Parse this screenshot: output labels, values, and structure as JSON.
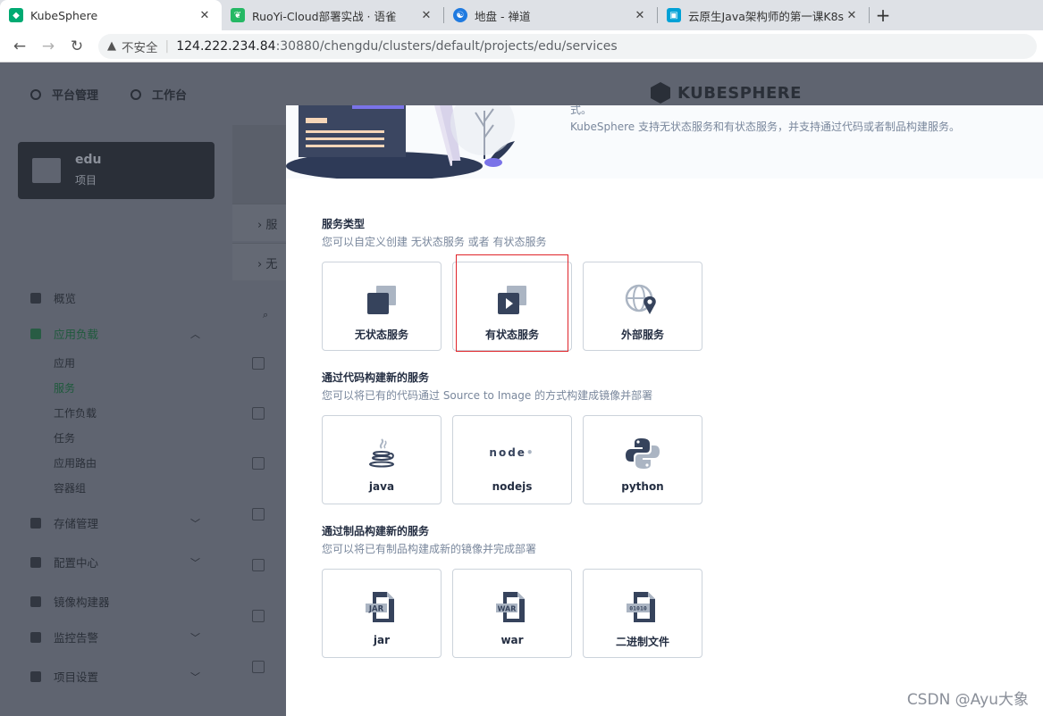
{
  "browser": {
    "tabs": [
      {
        "title": "KubeSphere",
        "color": "#00aa72",
        "active": true
      },
      {
        "title": "RuoYi-Cloud部署实战 · 语雀",
        "color": "#25b864",
        "active": false
      },
      {
        "title": "地盘 - 禅道",
        "color": "#1f7ae0",
        "active": false
      },
      {
        "title": "云原生Java架构师的第一课K8s+",
        "color": "#00a1d6",
        "active": false
      }
    ],
    "new_tab_glyph": "+",
    "close_glyph": "✕",
    "insecure_label": "不安全",
    "url_host": "124.222.234.84",
    "url_rest": ":30880/chengdu/clusters/default/projects/edu/services"
  },
  "topnav": {
    "platform": "平台管理",
    "workbench": "工作台",
    "brand": "KUBESPHERE"
  },
  "sidebar": {
    "project_name": "edu",
    "project_type": "项目",
    "items": [
      {
        "label": "概览"
      },
      {
        "label": "应用负载"
      },
      {
        "label": "存储管理"
      },
      {
        "label": "配置中心"
      },
      {
        "label": "镜像构建器"
      },
      {
        "label": "监控告警"
      },
      {
        "label": "项目设置"
      }
    ],
    "subitems": [
      "应用",
      "服务",
      "工作负载",
      "任务",
      "应用路由",
      "容器组"
    ]
  },
  "dim_rows": [
    "服",
    "无"
  ],
  "panel": {
    "header_trunc": "式。",
    "header_desc": "KubeSphere 支持无状态服务和有状态服务，并支持通过代码或者制品构建服务。",
    "sections": [
      {
        "title": "服务类型",
        "desc": "您可以自定义创建 无状态服务 或者 有状态服务",
        "cards": [
          {
            "label": "无状态服务",
            "icon": "stateless-service-icon"
          },
          {
            "label": "有状态服务",
            "icon": "stateful-service-icon"
          },
          {
            "label": "外部服务",
            "icon": "external-service-icon"
          }
        ]
      },
      {
        "title": "通过代码构建新的服务",
        "desc": "您可以将已有的代码通过 Source to Image 的方式构建成镜像并部署",
        "cards": [
          {
            "label": "java",
            "icon": "java-icon"
          },
          {
            "label": "nodejs",
            "icon": "nodejs-icon"
          },
          {
            "label": "python",
            "icon": "python-icon"
          }
        ]
      },
      {
        "title": "通过制品构建新的服务",
        "desc": "您可以将已有制品构建成新的镜像并完成部署",
        "cards": [
          {
            "label": "jar",
            "icon": "jar-file-icon"
          },
          {
            "label": "war",
            "icon": "war-file-icon"
          },
          {
            "label": "二进制文件",
            "icon": "binary-file-icon"
          }
        ]
      }
    ],
    "icon_text": {
      "nodejs": "node",
      "jar": "JAR",
      "war": "WAR",
      "binary": "01010"
    }
  },
  "watermark": "CSDN @Ayu大象"
}
